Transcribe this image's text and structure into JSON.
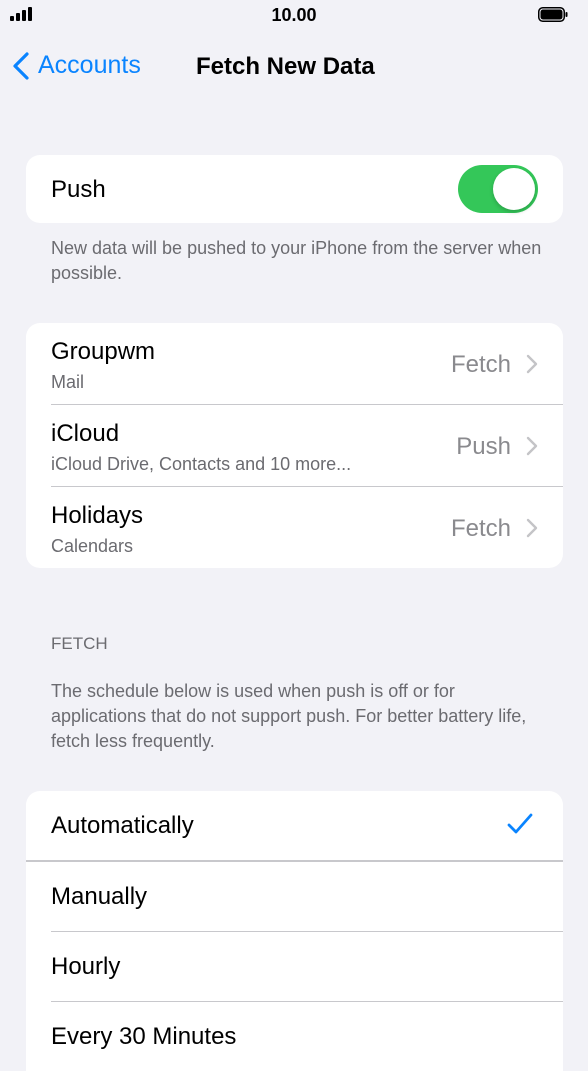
{
  "status_bar": {
    "time": "10.00"
  },
  "nav": {
    "back_label": "Accounts",
    "title": "Fetch New Data"
  },
  "push": {
    "label": "Push",
    "toggle_on": true,
    "footer": "New data will be pushed to your iPhone from the server when possible."
  },
  "accounts": [
    {
      "name": "Groupwm",
      "detail": "Mail",
      "mode": "Fetch"
    },
    {
      "name": "iCloud",
      "detail": "iCloud Drive, Contacts and 10 more...",
      "mode": "Push"
    },
    {
      "name": "Holidays",
      "detail": "Calendars",
      "mode": "Fetch"
    }
  ],
  "fetch": {
    "header": "FETCH",
    "description": "The schedule below is used when push is off or for applications that do not support push. For better battery life, fetch less frequently.",
    "options": [
      {
        "label": "Automatically",
        "selected": true
      },
      {
        "label": "Manually",
        "selected": false
      },
      {
        "label": "Hourly",
        "selected": false
      },
      {
        "label": "Every 30 Minutes",
        "selected": false
      }
    ]
  },
  "colors": {
    "accent": "#0a84ff",
    "toggle_on": "#34c759",
    "background": "#f2f2f7"
  }
}
